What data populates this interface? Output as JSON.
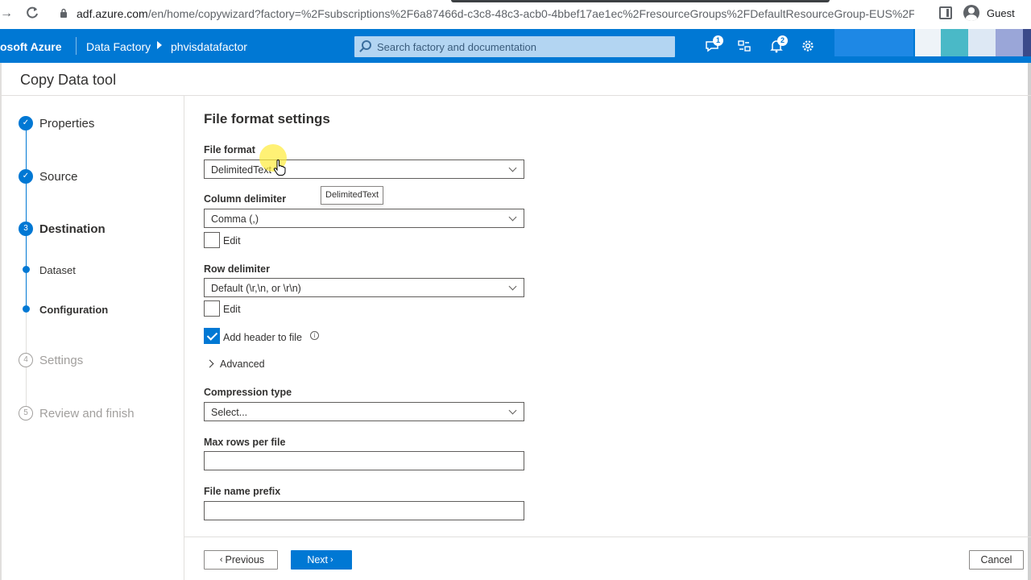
{
  "browser": {
    "url_host": "adf.azure.com",
    "url_rest": "/en/home/copywizard?factory=%2Fsubscriptions%2F6a87466d-c3c8-48c3-acb0-4bbef17ae1ec%2FresourceGroups%2FDefaultResourceGroup-EUS%2Fpr...",
    "profile_label": "Guest"
  },
  "header": {
    "brand": "osoft Azure",
    "breadcrumb": [
      "Data Factory",
      "phvisdatafactor"
    ],
    "search_placeholder": "Search factory and documentation",
    "feedback_badge": "1",
    "notifications_badge": "2",
    "accent_color": "#0078d4"
  },
  "page": {
    "title": "Copy Data tool"
  },
  "steps": [
    {
      "label": "Properties",
      "marker": "✓",
      "state": "done"
    },
    {
      "label": "Source",
      "marker": "✓",
      "state": "done"
    },
    {
      "label": "Destination",
      "marker": "3",
      "state": "current"
    },
    {
      "label": "Dataset",
      "state": "sub"
    },
    {
      "label": "Configuration",
      "state": "sub-current"
    },
    {
      "label": "Settings",
      "marker": "4",
      "state": "todo"
    },
    {
      "label": "Review and finish",
      "marker": "5",
      "state": "todo"
    }
  ],
  "form": {
    "section_title": "File format settings",
    "file_format": {
      "label": "File format",
      "value": "DelimitedText"
    },
    "tooltip": "DelimitedText",
    "column_delimiter": {
      "label": "Column delimiter",
      "value": "Comma (,)",
      "edit_label": "Edit",
      "edit_checked": false
    },
    "row_delimiter": {
      "label": "Row delimiter",
      "value": "Default (\\r,\\n, or \\r\\n)",
      "edit_label": "Edit",
      "edit_checked": false
    },
    "add_header": {
      "label": "Add header to file",
      "checked": true
    },
    "advanced_label": "Advanced",
    "compression": {
      "label": "Compression type",
      "value": "Select..."
    },
    "max_rows": {
      "label": "Max rows per file",
      "value": ""
    },
    "file_prefix": {
      "label": "File name prefix",
      "value": ""
    }
  },
  "footer": {
    "previous_label": "Previous",
    "next_label": "Next",
    "cancel_label": "Cancel"
  }
}
